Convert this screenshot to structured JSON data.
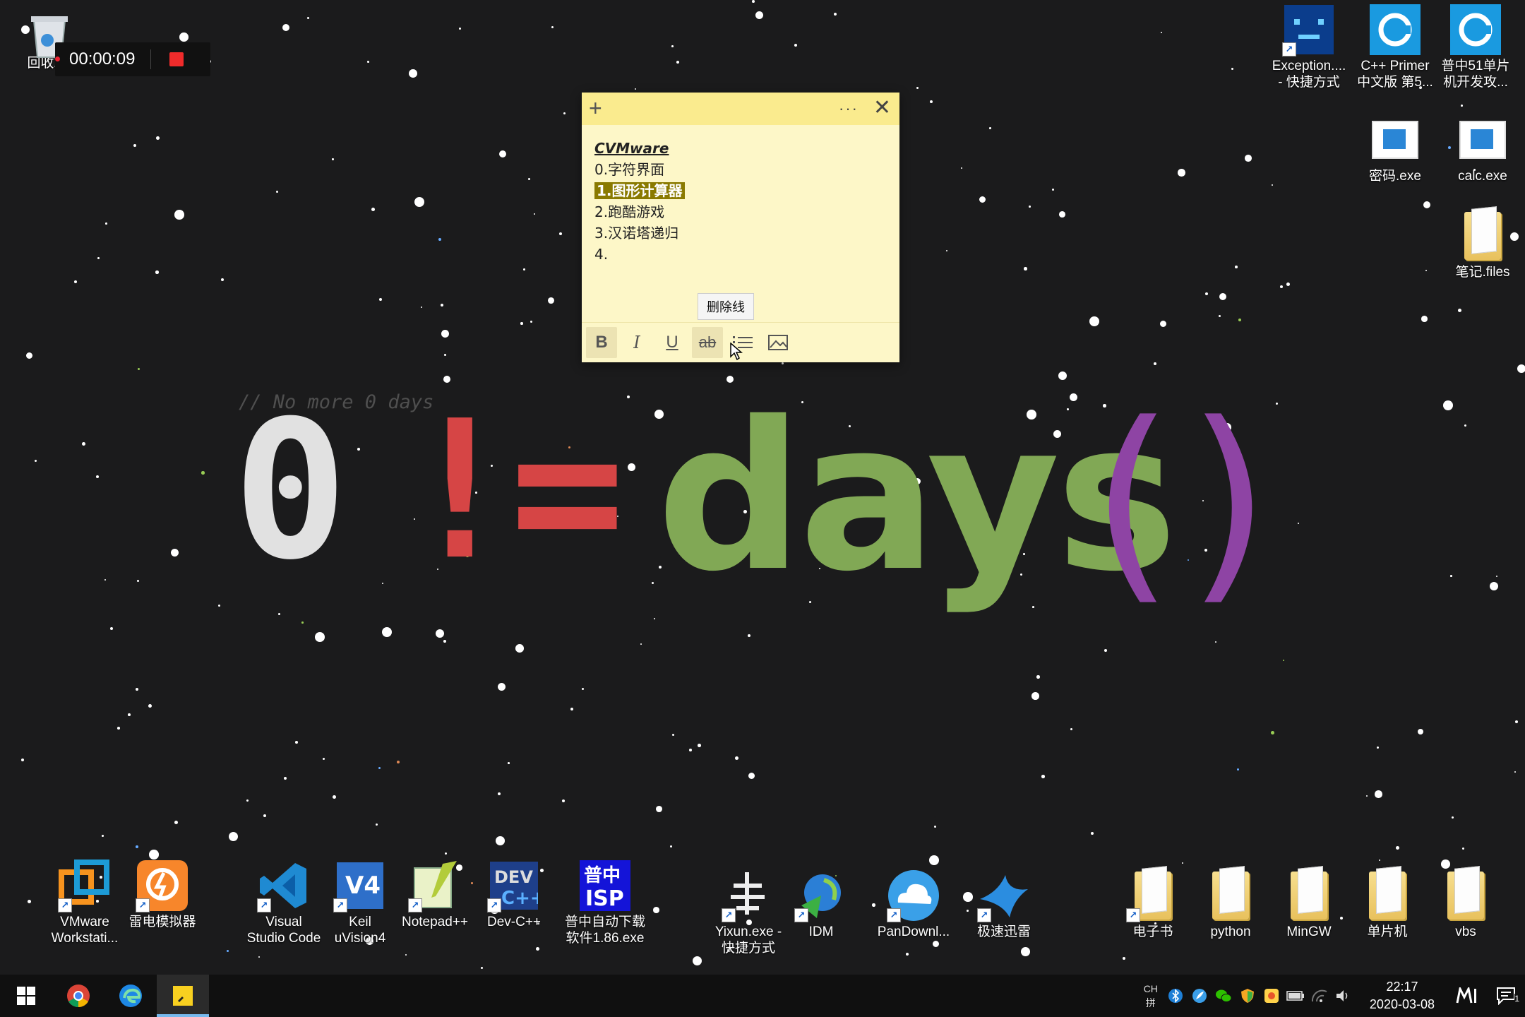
{
  "wallpaper": {
    "comment": "// No more 0 days",
    "zero": "0",
    "neq": "!=",
    "days": "days",
    "parens": "()",
    "colors": {
      "zero": "#e1e1e1",
      "neq": "#d64545",
      "days": "#81a855",
      "parens": "#8e44a4"
    }
  },
  "recorder": {
    "time": "00:00:09"
  },
  "recycle_bin": {
    "label": "回收站"
  },
  "top_right_icons": [
    {
      "label": "Exception....\n- 快捷方式",
      "icon": "exception-app-icon"
    },
    {
      "label": "C++ Primer\n中文版 第5...",
      "icon": "cpp-primer-icon"
    },
    {
      "label": "普中51单片\n机开发攻...",
      "icon": "pz51-icon"
    },
    {
      "label": "密码.exe",
      "icon": "exe-icon"
    },
    {
      "label": "calc.exe",
      "icon": "exe-icon"
    },
    {
      "label": "笔记.files",
      "icon": "folder-icon"
    }
  ],
  "bottom_icons": [
    {
      "label": "VMware\nWorkstati...",
      "icon": "vmware-icon"
    },
    {
      "label": "雷电模拟器",
      "icon": "ldplayer-icon"
    },
    {
      "label": "Visual\nStudio Code",
      "icon": "vscode-icon"
    },
    {
      "label": "Keil\nuVision4",
      "icon": "keil-icon"
    },
    {
      "label": "Notepad++",
      "icon": "notepadpp-icon"
    },
    {
      "label": "Dev-C++",
      "icon": "devcpp-icon"
    },
    {
      "label": "普中自动下载\n软件1.86.exe",
      "icon": "pz-isp-icon"
    },
    {
      "label": "Yixun.exe -\n快捷方式",
      "icon": "yixun-icon"
    },
    {
      "label": "IDM",
      "icon": "idm-icon"
    },
    {
      "label": "PanDownl...",
      "icon": "pandownload-icon"
    },
    {
      "label": "极速迅雷",
      "icon": "xunlei-icon"
    },
    {
      "label": "电子书",
      "icon": "folder-icon"
    },
    {
      "label": "python",
      "icon": "folder-icon"
    },
    {
      "label": "MinGW",
      "icon": "folder-icon"
    },
    {
      "label": "单片机",
      "icon": "folder-icon"
    },
    {
      "label": "vbs",
      "icon": "folder-icon"
    }
  ],
  "sticky_note": {
    "title": "CVMware",
    "lines": [
      "0.字符界面",
      "1.图形计算器",
      "2.跑酷游戏",
      "3.汉诺塔递归",
      "4."
    ],
    "toolbar": {
      "bold": "B",
      "italic": "I",
      "underline": "U",
      "strike": "ab"
    },
    "tooltip": "删除线"
  },
  "taskbar": {
    "lang_top": "CH",
    "lang_bottom": "拼",
    "time": "22:17",
    "date": "2020-03-08",
    "notification_count": "1"
  }
}
